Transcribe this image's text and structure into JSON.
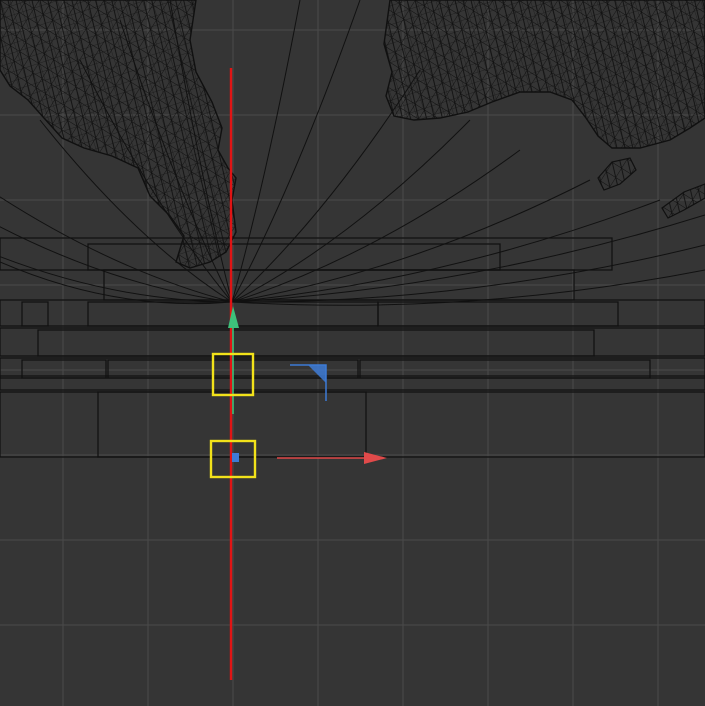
{
  "viewport": {
    "kind": "3d-orthographic-viewport",
    "render_mode": "wireframe",
    "background_color": "#353535",
    "grid_color": "#4a4a4a",
    "wire_color": "#111111"
  },
  "gizmo": {
    "x_axis_color": "#e04a4a",
    "y_axis_color": "#3ec07a",
    "z_axis_color": "#3d7bd6",
    "selection_line_color": "#e01414",
    "selection_box_color": "#f2e21a"
  },
  "icons": {
    "move_gizmo": "transform-move-icon",
    "plane_handle": "plane-handle-icon",
    "pivot_handle": "pivot-point-icon"
  }
}
